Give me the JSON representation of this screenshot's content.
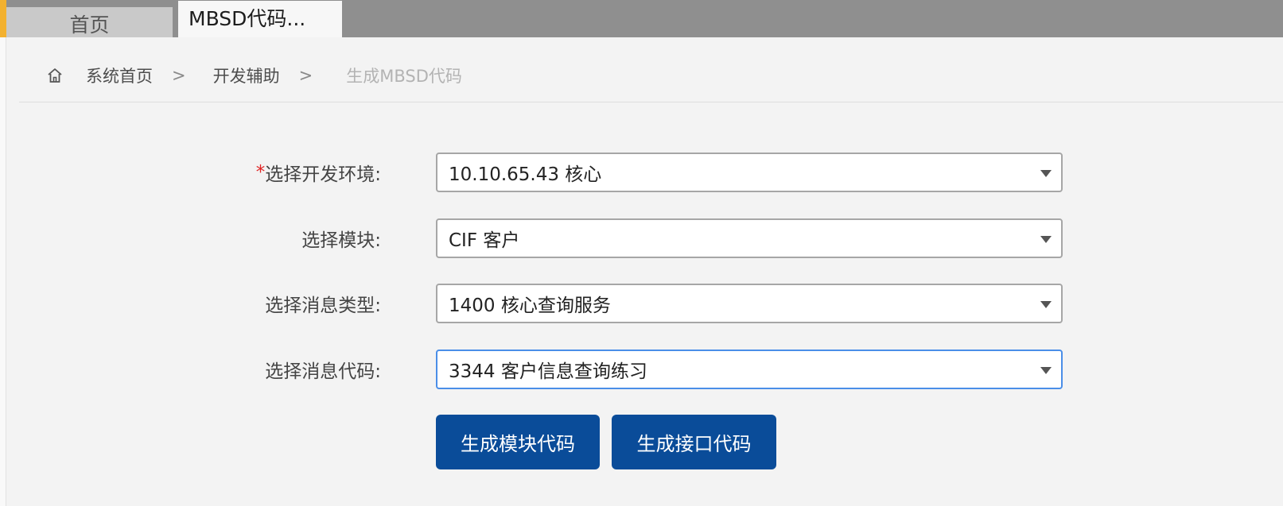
{
  "tabs": {
    "home": "首页",
    "active": "MBSD代码..."
  },
  "breadcrumb": {
    "icon": "home-icon",
    "items": [
      "系统首页",
      "开发辅助",
      "生成MBSD代码"
    ],
    "separator": ">"
  },
  "form": {
    "required_mark": "*",
    "fields": [
      {
        "label": "选择开发环境:",
        "value": "10.10.65.43 核心"
      },
      {
        "label": "选择模块:",
        "value": "CIF 客户"
      },
      {
        "label": "选择消息类型:",
        "value": "1400 核心查询服务"
      },
      {
        "label": "选择消息代码:",
        "value": "3344 客户信息查询练习"
      }
    ]
  },
  "buttons": {
    "generate_module": "生成模块代码",
    "generate_interface": "生成接口代码"
  },
  "colors": {
    "primary_button": "#0a4c99",
    "tab_accent": "#f3b12f",
    "focus_border": "#4a8ee8",
    "required": "#e02424"
  }
}
